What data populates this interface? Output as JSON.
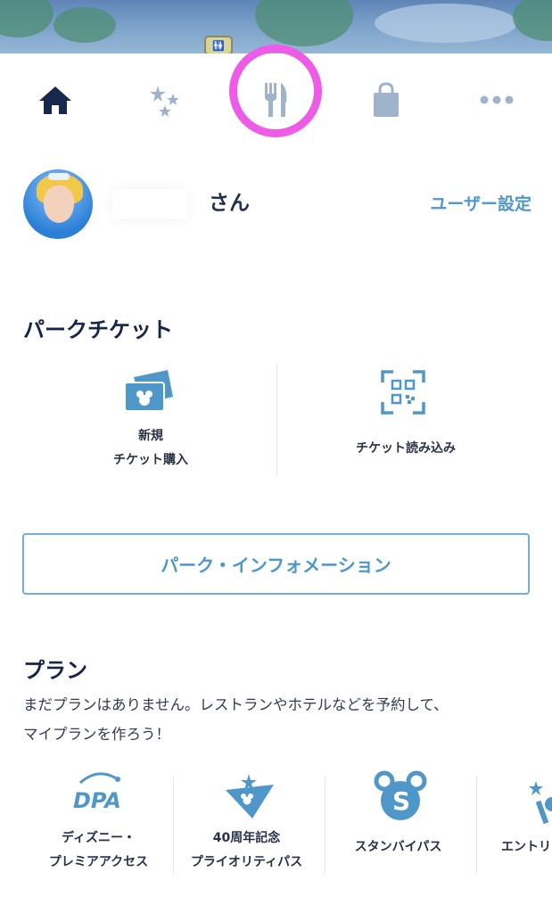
{
  "map": {
    "restroom_marker_icon": "restroom-icon"
  },
  "tabs": [
    {
      "icon": "home-icon",
      "active": true
    },
    {
      "icon": "stars-icon",
      "active": false
    },
    {
      "icon": "fork-knife-icon",
      "active": false,
      "highlighted": true
    },
    {
      "icon": "shopping-bag-icon",
      "active": false
    },
    {
      "icon": "more-icon",
      "active": false
    }
  ],
  "profile": {
    "honorific": "さん",
    "settings_link": "ユーザー設定"
  },
  "tickets": {
    "title": "パークチケット",
    "buy": {
      "line1": "新規",
      "line2": "チケット購入",
      "icon": "ticket-mickey-icon"
    },
    "scan": {
      "label": "チケット読み込み",
      "icon": "qr-scan-icon"
    }
  },
  "park_info_button": "パーク・インフォメーション",
  "plan": {
    "title": "プラン",
    "description_line1": "まだプランはありません。レストランやホテルなどを予約して、",
    "description_line2": "マイプランを作ろう！",
    "items": [
      {
        "line1": "ディズニー・",
        "line2": "プレミアアクセス",
        "icon": "dpa-logo-icon",
        "icon_text": "DPA"
      },
      {
        "line1": "40周年記念",
        "line2": "プライオリティパス",
        "icon": "priority-pass-icon"
      },
      {
        "line1": "スタンバイパス",
        "line2": "",
        "icon": "standby-pass-icon",
        "icon_text": "S"
      },
      {
        "line1": "エントリ",
        "line2": "",
        "icon": "entry-wand-icon"
      }
    ]
  },
  "colors": {
    "accent_blue": "#4f97c9",
    "navy": "#15264a",
    "highlight_pink": "#ee5ce7",
    "inactive_icon": "#9fb3cc"
  }
}
